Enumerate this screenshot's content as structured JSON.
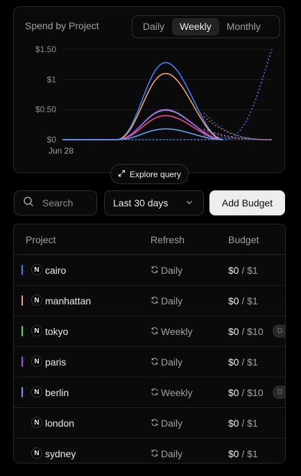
{
  "chart": {
    "title": "Spend by Project",
    "periods": [
      "Daily",
      "Weekly",
      "Monthly"
    ],
    "active_period": "Weekly",
    "explore_label": "Explore query"
  },
  "chart_data": {
    "type": "line",
    "y_ticks": [
      "$1.50",
      "$1",
      "$0.50",
      "$0"
    ],
    "x_tick": "Jun 28",
    "ylim": [
      0,
      1.5
    ],
    "grid": true,
    "series": [
      {
        "color": "#3b82f6",
        "peak": 1.28,
        "style": "solid"
      },
      {
        "color": "#f5a564",
        "peak": 1.1,
        "style": "solid"
      },
      {
        "color": "#4ade80",
        "peak": 0.49,
        "style": "solid"
      },
      {
        "color": "#a855f7",
        "peak": 0.5,
        "style": "solid"
      },
      {
        "color": "#ec4899",
        "peak": 0.4,
        "style": "solid"
      },
      {
        "color": "#60a5fa",
        "peak": 0.18,
        "style": "solid"
      },
      {
        "color": "#3b82f6",
        "end_value": 1.5,
        "style": "dotted"
      }
    ]
  },
  "toolbar": {
    "search_placeholder": "Search",
    "range_label": "Last 30 days",
    "add_label": "Add Budget"
  },
  "table": {
    "headers": {
      "project": "Project",
      "refresh": "Refresh",
      "budget": "Budget"
    },
    "rows": [
      {
        "color": "#3b82f6",
        "name": "cairo",
        "refresh": "Daily",
        "spent": "$0",
        "limit": "/ $1",
        "badge": ""
      },
      {
        "color": "#f5a564",
        "name": "manhattan",
        "refresh": "Daily",
        "spent": "$0",
        "limit": "/ $1",
        "badge": ""
      },
      {
        "color": "#4ade80",
        "name": "tokyo",
        "refresh": "Weekly",
        "spent": "$0",
        "limit": "/ $10",
        "badge": "D"
      },
      {
        "color": "#a855f7",
        "name": "paris",
        "refresh": "Daily",
        "spent": "$0",
        "limit": "/ $1",
        "badge": ""
      },
      {
        "color": "#60a5fa",
        "name": "berlin",
        "refresh": "Weekly",
        "spent": "$0",
        "limit": "/ $10",
        "badge": "D"
      },
      {
        "color": "",
        "name": "london",
        "refresh": "Daily",
        "spent": "$0",
        "limit": "/ $1",
        "badge": ""
      },
      {
        "color": "",
        "name": "sydney",
        "refresh": "Daily",
        "spent": "$0",
        "limit": "/ $1",
        "badge": ""
      }
    ],
    "logo_letter": "N"
  }
}
